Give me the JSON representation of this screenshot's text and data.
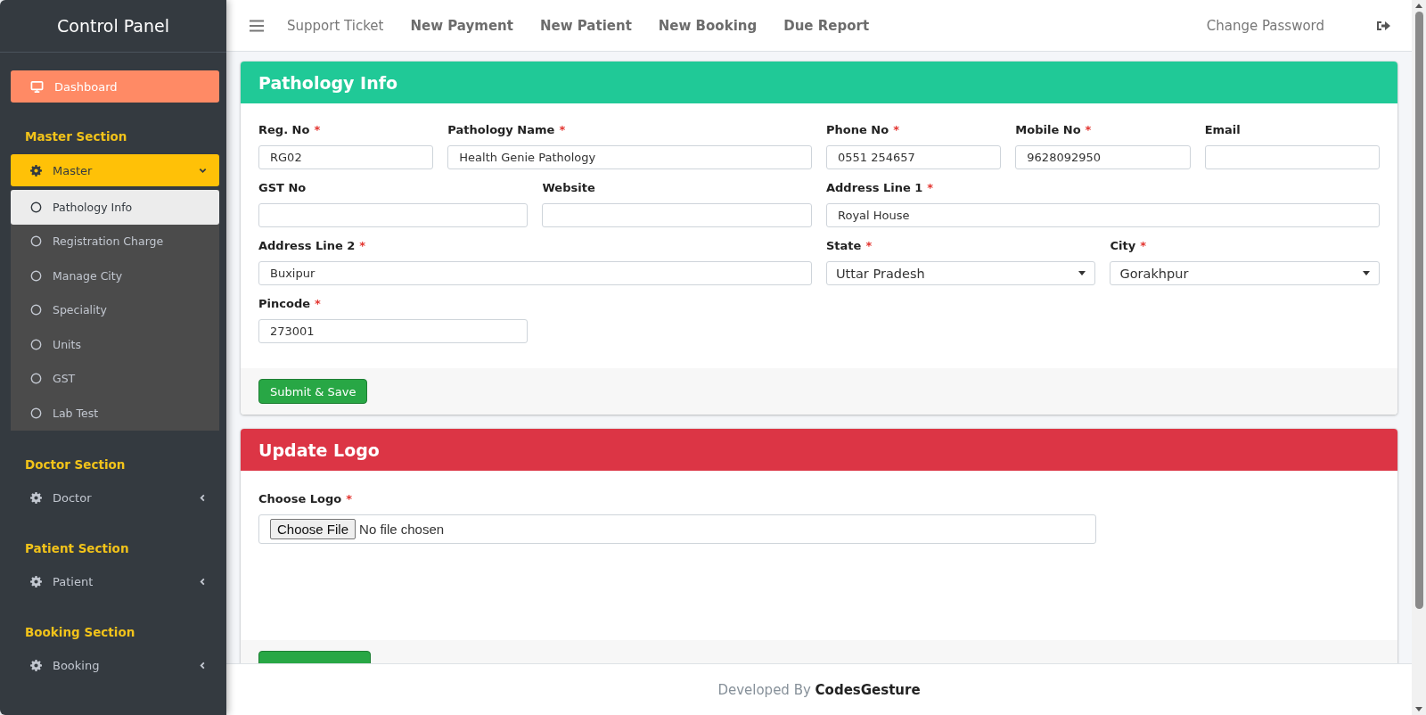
{
  "sidebar": {
    "title": "Control Panel",
    "items": [
      {
        "kind": "link",
        "label": "Dashboard",
        "selected": false,
        "highlighted": true
      },
      {
        "kind": "heading",
        "label": "Master Section"
      },
      {
        "kind": "menu",
        "label": "Master",
        "expanded": true,
        "children": [
          {
            "label": "Pathology Info",
            "selected": true
          },
          {
            "label": "Registration Charge",
            "selected": false
          },
          {
            "label": "Manage City",
            "selected": false
          },
          {
            "label": "Speciality",
            "selected": false
          },
          {
            "label": "Units",
            "selected": false
          },
          {
            "label": "GST",
            "selected": false
          },
          {
            "label": "Lab Test",
            "selected": false
          }
        ]
      },
      {
        "kind": "heading",
        "label": "Doctor Section"
      },
      {
        "kind": "menu",
        "label": "Doctor",
        "expanded": false
      },
      {
        "kind": "heading",
        "label": "Patient Section"
      },
      {
        "kind": "menu",
        "label": "Patient",
        "expanded": false
      },
      {
        "kind": "heading",
        "label": "Booking Section"
      },
      {
        "kind": "menu",
        "label": "Booking",
        "expanded": false
      }
    ]
  },
  "topbar": {
    "links": [
      {
        "label": "Support Ticket",
        "bold": false
      },
      {
        "label": "New Payment",
        "bold": true
      },
      {
        "label": "New Patient",
        "bold": true
      },
      {
        "label": "New Booking",
        "bold": true
      },
      {
        "label": "Due Report",
        "bold": true
      }
    ],
    "right_link": "Change Password"
  },
  "pathology_card": {
    "title": "Pathology Info",
    "fields": [
      {
        "kind": "text",
        "label": "Reg. No",
        "required_mark": "*",
        "value": "RG02"
      },
      {
        "kind": "text",
        "label": "Pathology Name",
        "required_mark": "*",
        "value": "Health Genie Pathology"
      },
      {
        "kind": "text",
        "label": "Phone No",
        "required_mark": "*",
        "value": "0551 254657"
      },
      {
        "kind": "text",
        "label": "Mobile No",
        "required_mark": "*",
        "value": "9628092950"
      },
      {
        "kind": "text",
        "label": "Email"
      },
      {
        "kind": "text",
        "label": "GST No"
      },
      {
        "kind": "text",
        "label": "Website"
      },
      {
        "kind": "text",
        "label": "Address Line 1",
        "required_mark": "*",
        "value": "Royal House"
      },
      {
        "kind": "text",
        "label": "Address Line 2",
        "required_mark": "*",
        "value": "Buxipur"
      },
      {
        "kind": "select",
        "label": "State",
        "required_mark": "*",
        "value": "Uttar Pradesh"
      },
      {
        "kind": "select",
        "label": "City",
        "required_mark": "*",
        "value": "Gorakhpur"
      },
      {
        "kind": "text",
        "label": "Pincode",
        "required_mark": "*",
        "value": "273001"
      }
    ],
    "button": "Submit & Save"
  },
  "logo_card": {
    "title": "Update Logo",
    "label": "Choose Logo",
    "required_mark": "*",
    "file_button": "Choose File",
    "file_status": "No file chosen"
  },
  "footer": {
    "text": "Developed By **CodesGesture**"
  }
}
